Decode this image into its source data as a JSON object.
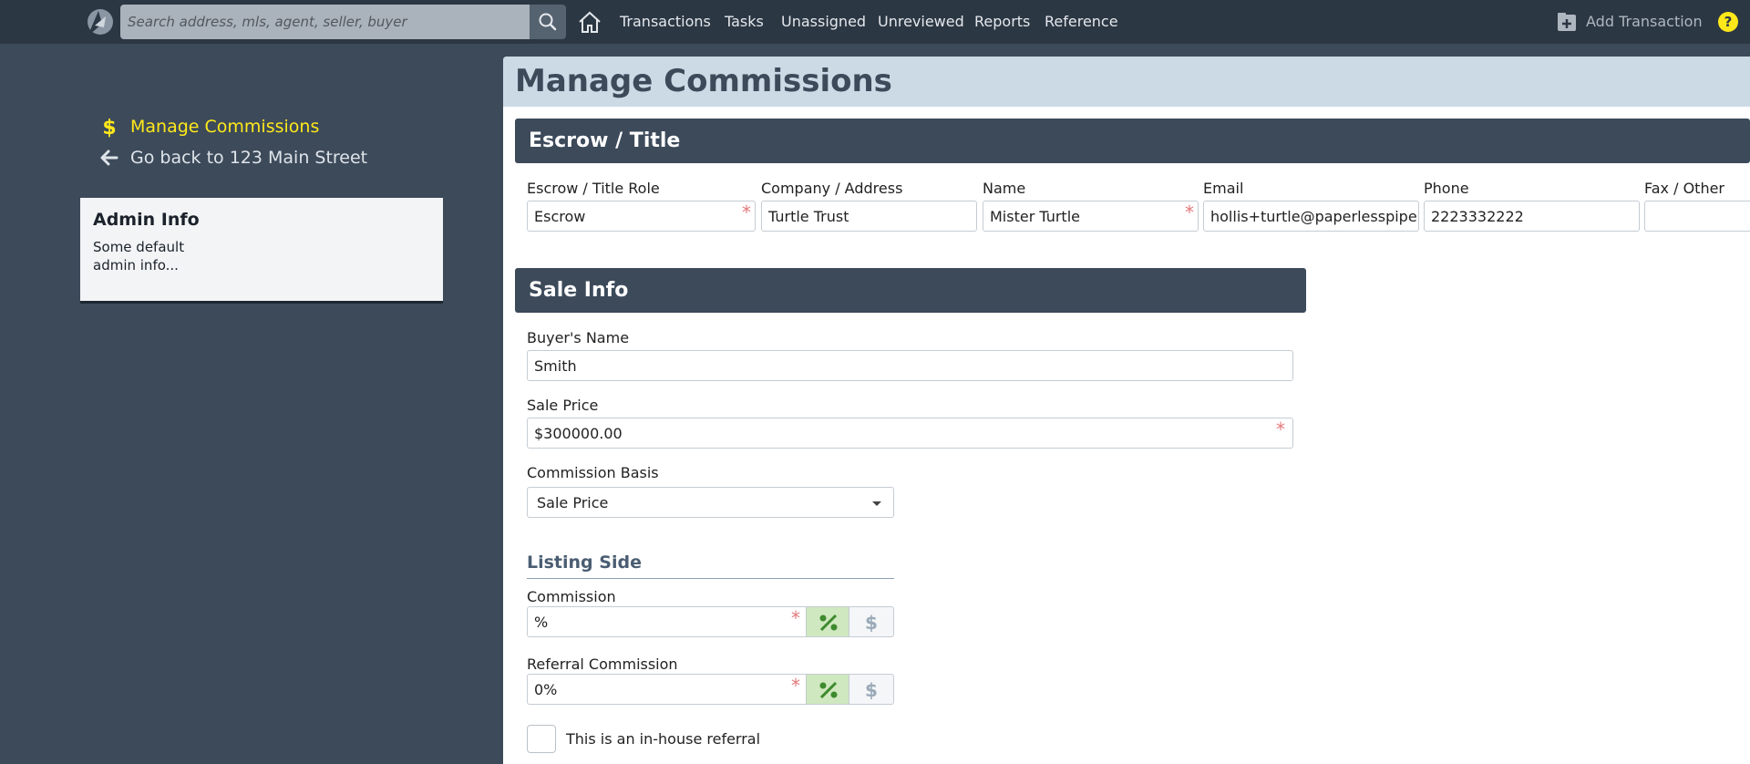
{
  "topbar": {
    "search_placeholder": "Search address, mls, agent, seller, buyer",
    "nav": [
      "Transactions",
      "Tasks",
      "Unassigned",
      "Unreviewed",
      "Reports",
      "Reference"
    ],
    "add_transaction": "Add Transaction"
  },
  "sidebar": {
    "manage_commissions": "Manage Commissions",
    "go_back": "Go back to 123 Main Street",
    "admin_title": "Admin Info",
    "admin_body": "Some default admin info..."
  },
  "page": {
    "title": "Manage Commissions"
  },
  "escrow": {
    "heading": "Escrow / Title",
    "columns": [
      "Escrow / Title Role",
      "Company / Address",
      "Name",
      "Email",
      "Phone",
      "Fax / Other"
    ],
    "values": [
      "Escrow",
      "Turtle Trust",
      "Mister Turtle",
      "hollis+turtle@paperlesspipeli",
      "2223332222",
      ""
    ]
  },
  "sale": {
    "heading": "Sale Info",
    "buyer_label": "Buyer's Name",
    "buyer_value": "Smith",
    "price_label": "Sale Price",
    "price_value": "$300000.00",
    "basis_label": "Commission Basis",
    "basis_value": "Sale Price"
  },
  "listing": {
    "heading": "Listing Side",
    "commission_label": "Commission",
    "commission_value": "%",
    "referral_label": "Referral Commission",
    "referral_value": "0%",
    "inhouse_label": "This is an in-house referral"
  },
  "colors": {
    "topbar": "#2c3744",
    "background": "#3c4a5a",
    "accent_yellow": "#ffe81a",
    "header_band": "#ccdae6",
    "required": "#e3797c",
    "toggle_on": "#cfe8bf"
  }
}
